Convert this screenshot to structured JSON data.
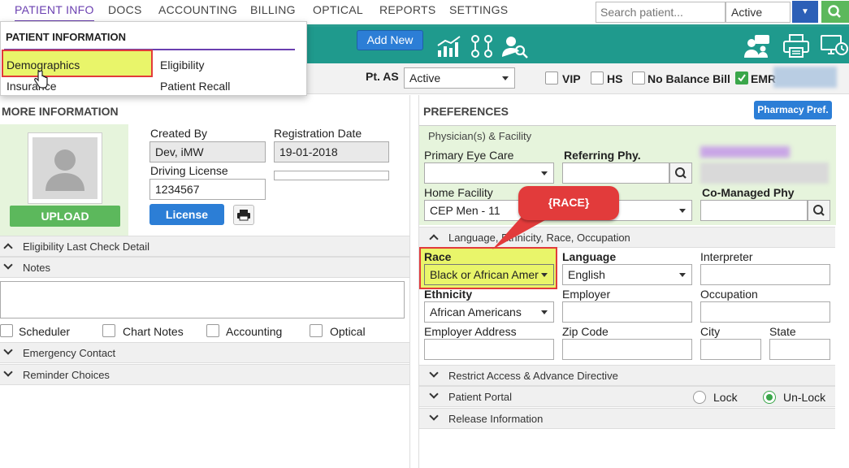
{
  "nav": {
    "tabs": [
      "PATIENT INFO",
      "DOCS",
      "ACCOUNTING",
      "BILLING",
      "OPTICAL",
      "REPORTS",
      "SETTINGS"
    ],
    "search_placeholder": "Search patient...",
    "status_value": "Active"
  },
  "toolbar": {
    "add_new": "Add New"
  },
  "menu": {
    "title": "PATIENT INFORMATION",
    "items": [
      "Demographics",
      "Eligibility",
      "Insurance",
      "Patient Recall"
    ]
  },
  "subbar": {
    "pt_as_label": "Pt. AS",
    "pt_as_value": "Active",
    "checks": [
      "VIP",
      "HS",
      "No Balance Bill",
      "EMR"
    ]
  },
  "left": {
    "section_title": "MORE INFORMATION",
    "upload": "UPLOAD",
    "created_by_label": "Created By",
    "created_by_value": "Dev, iMW",
    "reg_date_label": "Registration Date",
    "reg_date_value": "19-01-2018",
    "dl_label": "Driving License",
    "dl_value": "1234567",
    "license_btn": "License",
    "rows": [
      "Eligibility Last Check Detail",
      "Notes",
      "Emergency Contact",
      "Reminder Choices"
    ],
    "note_checks": [
      "Scheduler",
      "Chart Notes",
      "Accounting",
      "Optical"
    ]
  },
  "right": {
    "section_title": "PREFERENCES",
    "pharmacy_btn": "Pharmacy Pref.",
    "physician_header": "Physician(s) & Facility",
    "primary_eye_care": "Primary Eye Care",
    "referring_phy": "Referring Phy.",
    "home_facility": "Home Facility",
    "home_facility_value": "CEP Men - 11",
    "co_managed": "Co-Managed Phy",
    "lang_header": "Language, Ethnicity, Race, Occupation",
    "race_label": "Race",
    "race_value": "Black or African Amer",
    "language_label": "Language",
    "language_value": "English",
    "interpreter_label": "Interpreter",
    "ethnicity_label": "Ethnicity",
    "ethnicity_value": "African Americans",
    "employer_label": "Employer",
    "occupation_label": "Occupation",
    "employer_address": "Employer Address",
    "zip": "Zip Code",
    "city": "City",
    "state": "State",
    "rows": [
      "Restrict Access & Advance Directive",
      "Patient Portal",
      "Release Information"
    ],
    "lock": "Lock",
    "unlock": "Un-Lock"
  },
  "callout": {
    "text": "{RACE}"
  },
  "colors": {
    "teal": "#1f9a8d",
    "purple": "#7b2fbe",
    "highlight": "#e9f56a",
    "red": "#e23b3b",
    "green": "#5cb85c"
  }
}
